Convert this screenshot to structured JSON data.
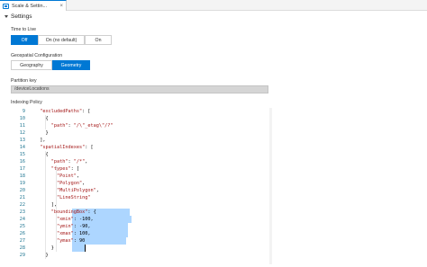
{
  "tab": {
    "label": "Scale & Settin...",
    "close": "×"
  },
  "settings": {
    "title": "Settings"
  },
  "ttl": {
    "label": "Time to Live",
    "options": [
      "Off",
      "On (no default)",
      "On"
    ],
    "selected": "Off"
  },
  "geo": {
    "label": "Geospatial Configuration",
    "options": [
      "Geography",
      "Geometry"
    ],
    "selected": "Geometry"
  },
  "partition": {
    "label": "Partition key",
    "value": "/deviceLocations"
  },
  "indexing": {
    "label": "Indexing Policy",
    "lines": [
      {
        "n": "9",
        "text": "  \"excludedPaths\": ["
      },
      {
        "n": "10",
        "text": "    {"
      },
      {
        "n": "11",
        "text": "      \"path\": \"/\\\"_etag\\\"/?\""
      },
      {
        "n": "12",
        "text": "    }"
      },
      {
        "n": "13",
        "text": "  ],"
      },
      {
        "n": "14",
        "text": "  \"spatialIndexes\": ["
      },
      {
        "n": "15",
        "text": "    {"
      },
      {
        "n": "16",
        "text": "      \"path\": \"/*\","
      },
      {
        "n": "17",
        "text": "      \"types\": ["
      },
      {
        "n": "18",
        "text": "        \"Point\","
      },
      {
        "n": "19",
        "text": "        \"Polygon\","
      },
      {
        "n": "20",
        "text": "        \"MultiPolygon\","
      },
      {
        "n": "21",
        "text": "        \"LineString\""
      },
      {
        "n": "22",
        "text": "      ],"
      },
      {
        "n": "23",
        "text": "      \"boundingBox\": {"
      },
      {
        "n": "24",
        "text": "        \"xmin\": -100,"
      },
      {
        "n": "25",
        "text": "        \"ymin\": -90,"
      },
      {
        "n": "26",
        "text": "        \"xmax\": 100,"
      },
      {
        "n": "27",
        "text": "        \"ymax\": 90"
      },
      {
        "n": "28",
        "text": "      }"
      },
      {
        "n": "29",
        "text": "    }"
      }
    ]
  }
}
